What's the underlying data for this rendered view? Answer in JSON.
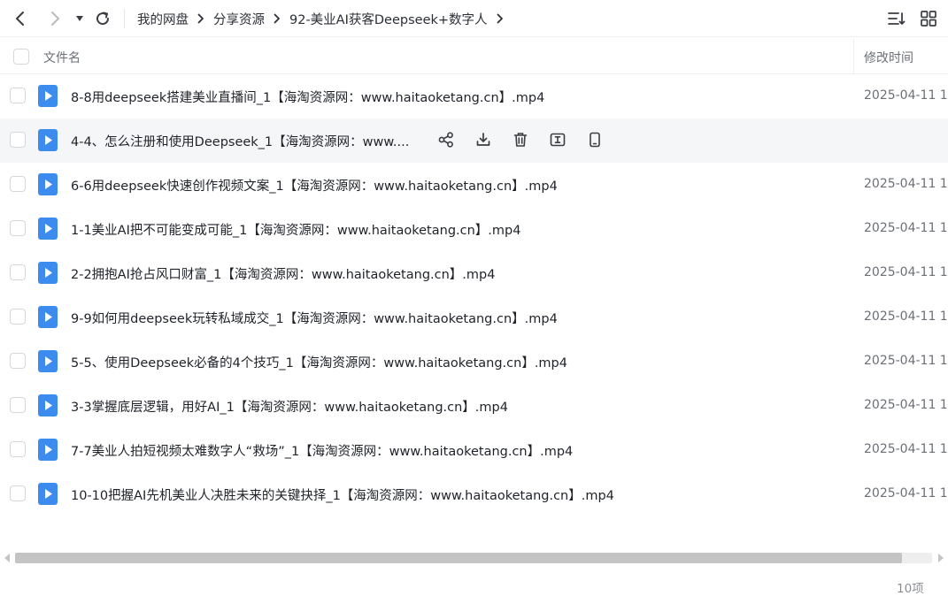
{
  "toolbar": {
    "back_icon": "chevron-left-icon",
    "forward_icon": "chevron-right-icon",
    "dropdown_icon": "caret-down-icon",
    "refresh_icon": "refresh-icon",
    "sort_icon": "sort-list-icon",
    "grid_icon": "grid-view-icon"
  },
  "breadcrumb": {
    "items": [
      "我的网盘",
      "分享资源",
      "92-美业AI获客Deepseek+数字人"
    ]
  },
  "header": {
    "name_label": "文件名",
    "time_label": "修改时间"
  },
  "files": [
    {
      "name": "8-8用deepseek搭建美业直播间_1【海淘资源网：www.haitaoketang.cn】.mp4",
      "time": "2025-04-11 1"
    },
    {
      "name": "4-4、怎么注册和使用Deepseek_1【海淘资源网：www....",
      "time": ""
    },
    {
      "name": "6-6用deepseek快速创作视频文案_1【海淘资源网：www.haitaoketang.cn】.mp4",
      "time": "2025-04-11 1"
    },
    {
      "name": "1-1美业AI把不可能变成可能_1【海淘资源网：www.haitaoketang.cn】.mp4",
      "time": "2025-04-11 1"
    },
    {
      "name": "2-2拥抱AI抢占风口财富_1【海淘资源网：www.haitaoketang.cn】.mp4",
      "time": "2025-04-11 1"
    },
    {
      "name": "9-9如何用deepseek玩转私域成交_1【海淘资源网：www.haitaoketang.cn】.mp4",
      "time": "2025-04-11 1"
    },
    {
      "name": "5-5、使用Deepseek必备的4个技巧_1【海淘资源网：www.haitaoketang.cn】.mp4",
      "time": "2025-04-11 1"
    },
    {
      "name": "3-3掌握底层逻辑，用好AI_1【海淘资源网：www.haitaoketang.cn】.mp4",
      "time": "2025-04-11 1"
    },
    {
      "name": "7-7美业人拍短视频太难数字人“救场”_1【海淘资源网：www.haitaoketang.cn】.mp4",
      "time": "2025-04-11 1"
    },
    {
      "name": "10-10把握AI先机美业人决胜未来的关键抉择_1【海淘资源网：www.haitaoketang.cn】.mp4",
      "time": "2025-04-11 1"
    }
  ],
  "hover_actions": [
    "share-icon",
    "download-icon",
    "delete-icon",
    "rename-icon",
    "phone-icon"
  ],
  "footer": {
    "count": "10项"
  },
  "colors": {
    "accent": "#3c8cf0",
    "hover_row": "#f5f6f8"
  }
}
